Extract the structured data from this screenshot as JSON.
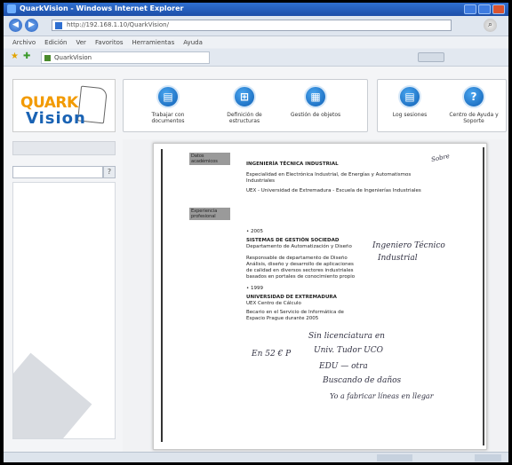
{
  "window": {
    "title": "QuarkVision - Windows Internet Explorer"
  },
  "address_bar": {
    "url": "http://192.168.1.10/QuarkVision/"
  },
  "menu": {
    "items": [
      "Archivo",
      "Edición",
      "Ver",
      "Favoritos",
      "Herramientas",
      "Ayuda"
    ]
  },
  "tabs": [
    {
      "label": "QuarkVision"
    }
  ],
  "logo": {
    "part1": "QUARK",
    "part2": "Vision"
  },
  "toolbar_left": [
    {
      "label": "Trabajar con documentos",
      "icon": "document-icon"
    },
    {
      "label": "Definición de estructuras",
      "icon": "structure-icon"
    },
    {
      "label": "Gestión de objetos",
      "icon": "objects-icon"
    }
  ],
  "toolbar_right": [
    {
      "label": "Log sesiones",
      "icon": "log-icon"
    },
    {
      "label": "Centro de Ayuda y Soporte",
      "icon": "help-icon"
    }
  ],
  "search": {
    "help": "?"
  },
  "document": {
    "section1": "Datos\nacadémicos",
    "section2": "Experiencia\nprofesional",
    "lines": [
      {
        "text": "INGENIERÍA TÉCNICA INDUSTRIAL",
        "bold": true
      },
      {
        "text": "Especialidad en Electrónica Industrial, de Energías y Automatismos",
        "bold": false
      },
      {
        "text": "Industriales",
        "bold": false
      },
      {
        "text": "UEX - Universidad de Extremadura - Escuela de Ingenierías Industriales",
        "bold": false
      },
      {
        "text": "• 2005",
        "bold": false
      },
      {
        "text": "SISTEMAS DE GESTIÓN SOCIEDAD",
        "bold": true
      },
      {
        "text": "Departamento de Automatización y Diseño",
        "bold": false
      },
      {
        "text": "Responsable de departamento de Diseño",
        "bold": false
      },
      {
        "text": "Análisis, diseño y desarrollo de aplicaciones",
        "bold": false
      },
      {
        "text": "de calidad en diversos sectores industriales",
        "bold": false
      },
      {
        "text": "basados en portales de conocimiento propio",
        "bold": false
      },
      {
        "text": "• 1999",
        "bold": false
      },
      {
        "text": "UNIVERSIDAD DE EXTREMADURA",
        "bold": true
      },
      {
        "text": "UEX Centro de Cálculo",
        "bold": false
      },
      {
        "text": "Becario en el Servicio de Informática de",
        "bold": false
      },
      {
        "text": "Espacio Prague durante 2005",
        "bold": false
      }
    ],
    "handwriting": [
      "Ingeniero Técnico",
      "Industrial",
      "Sin licenciatura en",
      "Univ. Tudor UCO",
      "EDU — otra",
      "Buscando de daños",
      "Yo a fabricar líneas en llegar",
      "En 52 € P",
      "Sobre"
    ]
  }
}
